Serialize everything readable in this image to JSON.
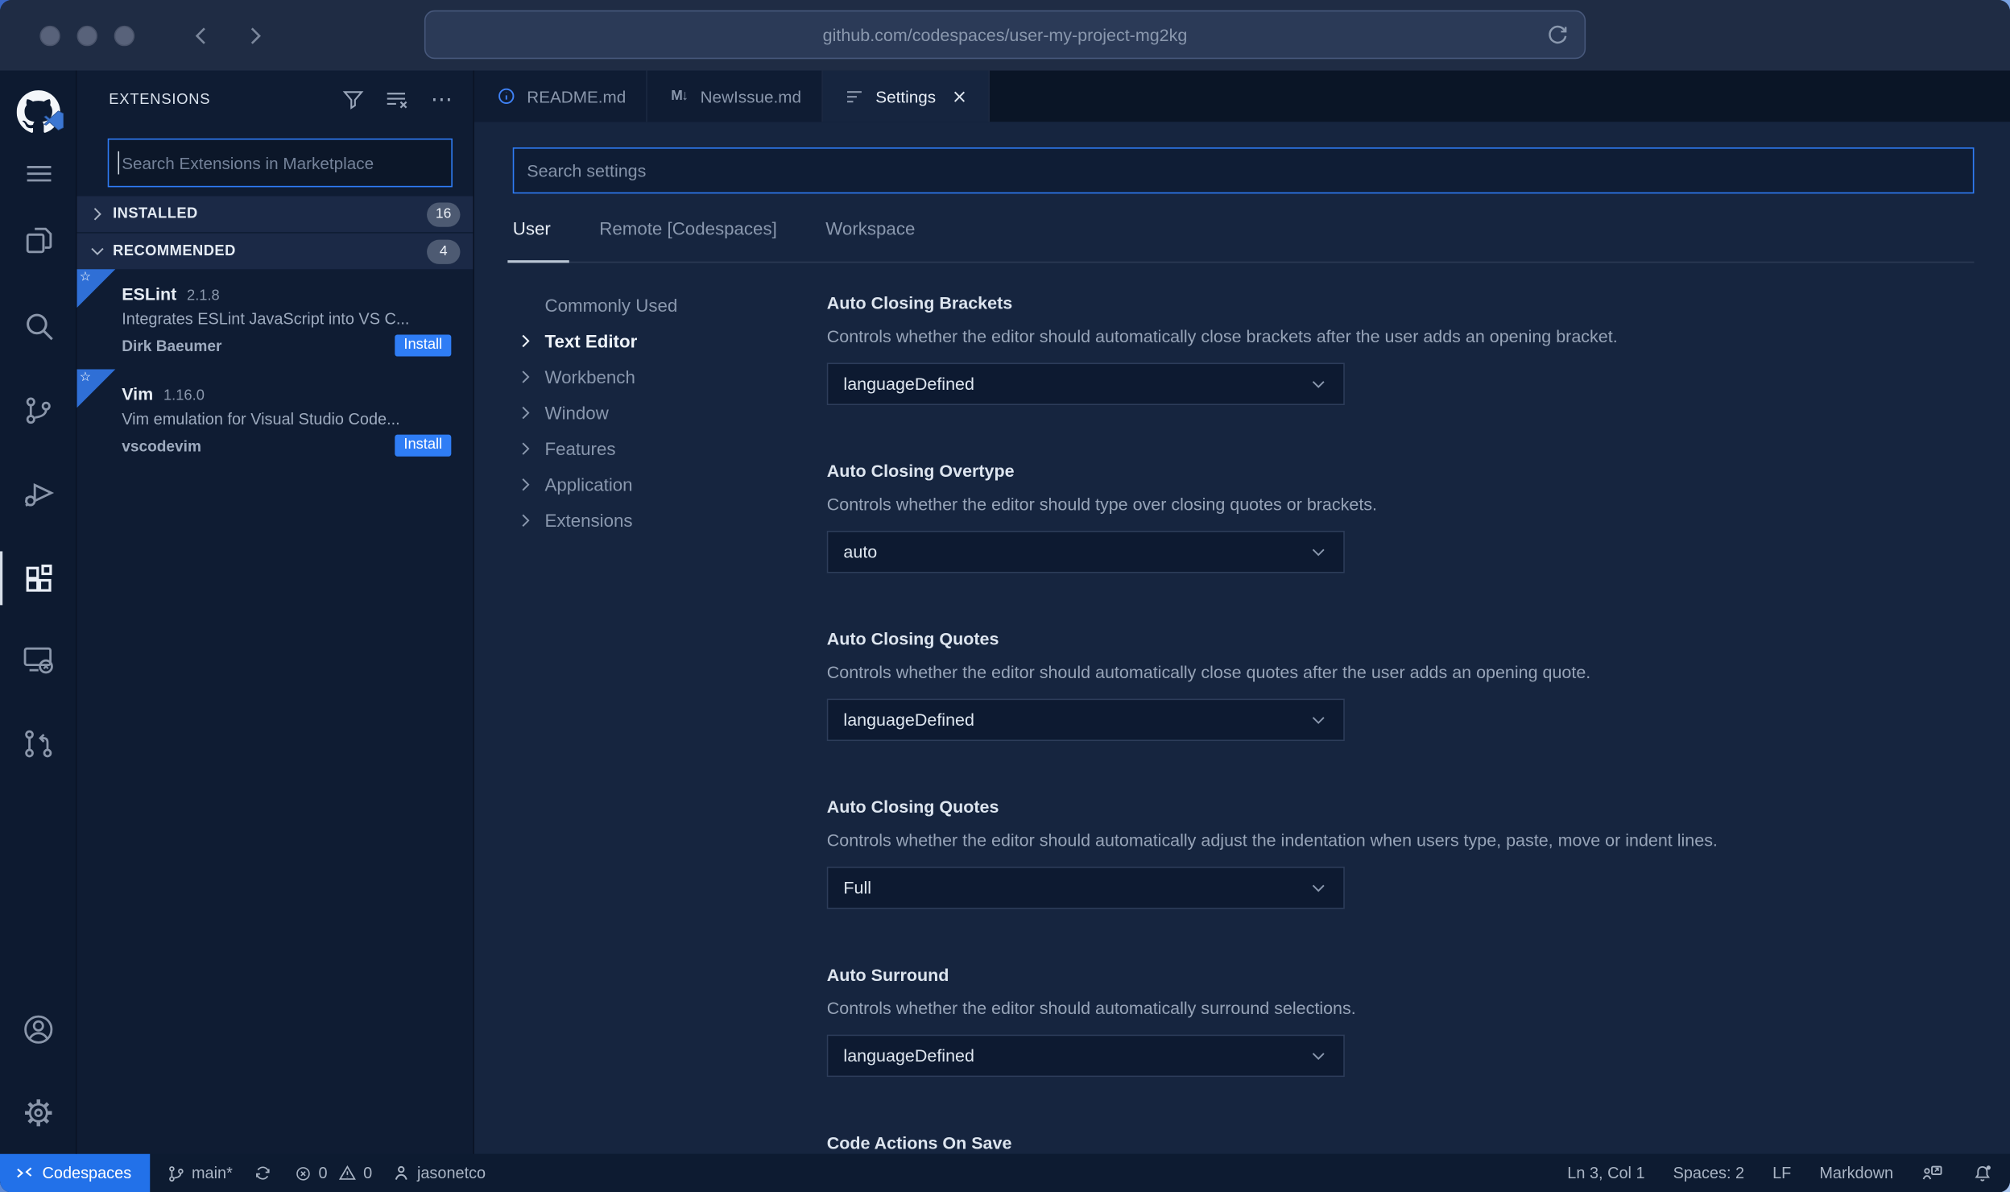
{
  "browser": {
    "url": "github.com/codespaces/user-my-project-mg2kg"
  },
  "icons": {
    "markdown_glyph": "M↓",
    "recommended_star": "☆",
    "ellipsis": "⋯"
  },
  "colors": {
    "accent": "#2f7cf6",
    "install_blue": "#2f7df5",
    "remote_segment_blue": "#2271e9",
    "editor_bg": "#16253f",
    "sidebar_bg": "#0f1c33"
  },
  "sidebar": {
    "title": "EXTENSIONS",
    "search_placeholder": "Search Extensions in Marketplace",
    "sections": [
      {
        "label": "INSTALLED",
        "count": "16"
      },
      {
        "label": "RECOMMENDED",
        "count": "4"
      }
    ],
    "extensions": [
      {
        "name": "ESLint",
        "version": "2.1.8",
        "description": "Integrates ESLint JavaScript into VS C...",
        "publisher": "Dirk Baeumer",
        "action": "Install"
      },
      {
        "name": "Vim",
        "version": "1.16.0",
        "description": "Vim emulation for Visual Studio Code...",
        "publisher": "vscodevim",
        "action": "Install"
      }
    ]
  },
  "tabs": [
    {
      "label": "README.md"
    },
    {
      "label": "NewIssue.md"
    },
    {
      "label": "Settings"
    }
  ],
  "settings": {
    "search_placeholder": "Search settings",
    "scopes": [
      "User",
      "Remote [Codespaces]",
      "Workspace"
    ],
    "toc": [
      "Commonly Used",
      "Text Editor",
      "Workbench",
      "Window",
      "Features",
      "Application",
      "Extensions"
    ],
    "items": [
      {
        "title": "Auto Closing Brackets",
        "description": "Controls whether the editor should automatically close brackets after the user adds an opening bracket.",
        "value": "languageDefined"
      },
      {
        "title": "Auto Closing Overtype",
        "description": "Controls whether the editor should type over closing quotes or brackets.",
        "value": "auto"
      },
      {
        "title": "Auto Closing Quotes",
        "description": "Controls whether the editor should automatically close quotes after the user adds an opening quote.",
        "value": "languageDefined"
      },
      {
        "title": "Auto Closing Quotes",
        "description": "Controls whether the editor should automatically adjust the indentation when users type, paste, move or indent lines.",
        "value": "Full"
      },
      {
        "title": "Auto Surround",
        "description": "Controls whether the editor should automatically surround selections.",
        "value": "languageDefined"
      },
      {
        "title": "Code Actions On Save",
        "description": "",
        "value": ""
      }
    ]
  },
  "status_bar": {
    "remote": "Codespaces",
    "branch": "main*",
    "errors": "0",
    "warnings": "0",
    "user": "jasonetco",
    "line_col": "Ln 3, Col 1",
    "indent": "Spaces: 2",
    "eol": "LF",
    "language": "Markdown"
  }
}
